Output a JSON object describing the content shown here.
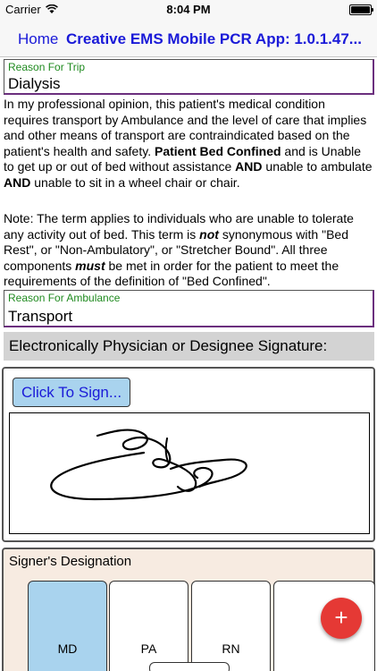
{
  "statusbar": {
    "carrier": "Carrier",
    "time": "8:04 PM"
  },
  "nav": {
    "back_label": "Home",
    "title": "Creative EMS Mobile PCR App: 1.0.1.47..."
  },
  "reason_trip": {
    "label": "Reason For Trip",
    "value": "Dialysis"
  },
  "medical_text": {
    "p1a": "In my professional opinion, this patient's medical condition requires transport by Ambulance and the level of care that implies and other means of transport are contraindicated based on the patient's health and safety. ",
    "p1b": "Patient Bed Confined",
    "p1c": " and is Unable to get up or out of bed without assistance ",
    "p1d": "AND",
    "p1e": " unable to ambulate ",
    "p1f": "AND",
    "p1g": " unable to sit in a wheel chair or chair.",
    "p2a": "Note: The term applies to individuals who are unable to tolerate any activity out of bed. This term is ",
    "p2b": "not",
    "p2c": " synonymous with \"Bed Rest\", or \"Non-Ambulatory\", or \"Stretcher Bound\". All three components ",
    "p2d": "must",
    "p2e": " be met in order for the patient to meet the requirements of the definition of \"Bed Confined\"."
  },
  "reason_ambulance": {
    "label": "Reason For Ambulance",
    "value": "Transport"
  },
  "signature": {
    "header": "Electronically Physician or Designee Signature:",
    "sign_button": "Click To Sign..."
  },
  "designation": {
    "label": "Signer's Designation",
    "options": [
      "MD",
      "PA",
      "RN"
    ],
    "selected": "MD",
    "add_label": "+"
  },
  "colors": {
    "nav_text": "#1a1ad8",
    "field_label": "#1f8a1f",
    "selected_option": "#a9d3ee",
    "fab": "#e53935"
  }
}
